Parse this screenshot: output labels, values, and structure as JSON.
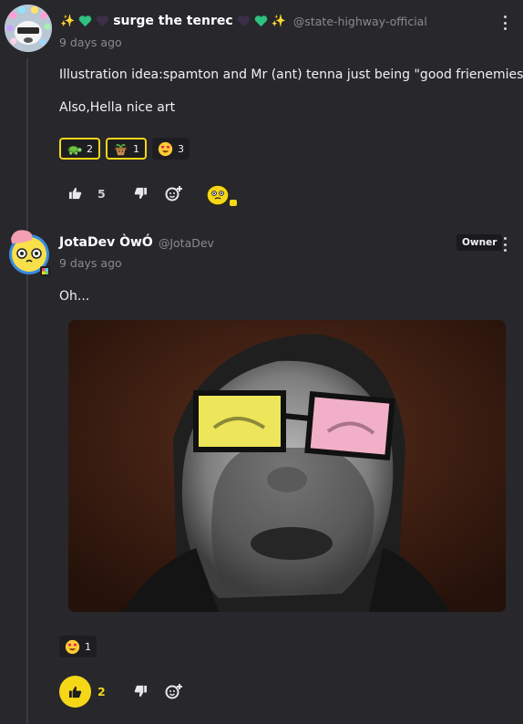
{
  "comments": [
    {
      "display_name": "surge the tenrec",
      "name_prefix_emojis": [
        "sparkles",
        "green-heart",
        "black-heart"
      ],
      "name_suffix_emojis": [
        "black-heart",
        "green-heart",
        "sparkles"
      ],
      "handle": "@state-highway-official",
      "timestamp": "9 days ago",
      "paragraphs": [
        "Illustration idea:spamton and Mr (ant) tenna just being \"good frienemies\"",
        "Also,Hella nice art"
      ],
      "reactions": [
        {
          "emoji": "turtle",
          "count": "2",
          "selected": true
        },
        {
          "emoji": "potted-plant-face",
          "count": "1",
          "selected": true
        },
        {
          "emoji": "heart-eyes",
          "count": "3",
          "selected": false
        }
      ],
      "likes": "5"
    },
    {
      "display_name": "JotaDev ÒwÓ",
      "handle": "@JotaDev",
      "badge": "Owner",
      "timestamp": "9 days ago",
      "paragraphs": [
        "Oh..."
      ],
      "reactions": [
        {
          "emoji": "heart-eyes",
          "count": "1",
          "selected": false
        }
      ],
      "likes": "2",
      "liked": true
    }
  ],
  "colors": {
    "background": "#28272b",
    "accent_yellow": "#f5d718",
    "secondary_text": "#8b8a90"
  }
}
